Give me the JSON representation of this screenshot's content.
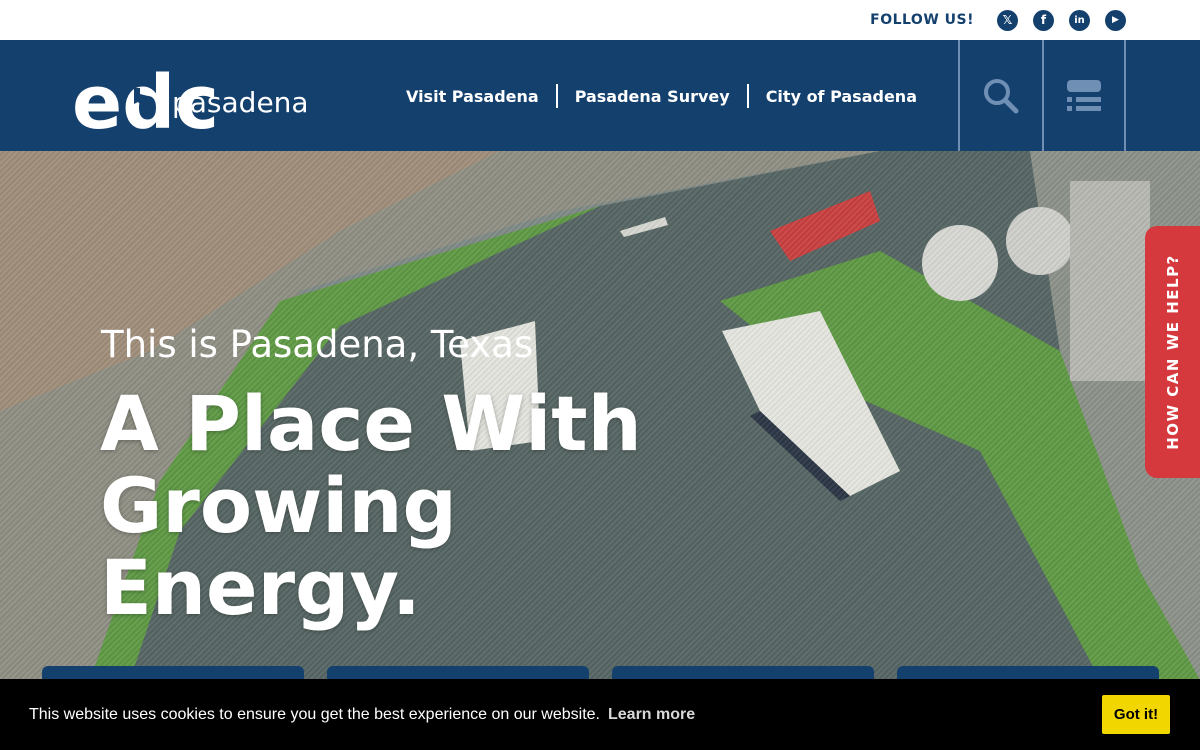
{
  "topbar": {
    "follow_label": "FOLLOW US!",
    "social": [
      {
        "icon": "x-twitter-icon",
        "glyph": "𝕏"
      },
      {
        "icon": "facebook-icon",
        "glyph": "f"
      },
      {
        "icon": "linkedin-icon",
        "glyph": "in"
      },
      {
        "icon": "youtube-icon",
        "glyph": "▶"
      }
    ]
  },
  "header": {
    "logo_text_left": "edc",
    "logo_text_right": "pasadena",
    "nav": [
      "Visit Pasadena",
      "Pasadena Survey",
      "City of Pasadena"
    ],
    "search_icon": "search-icon",
    "menu_icon": "menu-icon"
  },
  "hero": {
    "kicker": "This is Pasadena, Texas",
    "headline_lines": [
      "A Place With",
      "Growing",
      "Energy."
    ],
    "help_tab": "HOW CAN WE HELP?"
  },
  "cookie": {
    "message": "This website uses cookies to ensure you get the best experience on our website.",
    "learn_more": "Learn more",
    "accept": "Got it!"
  },
  "colors": {
    "brand_blue": "#14406e",
    "help_red": "#d6393d",
    "cookie_accept": "#f1d600"
  }
}
